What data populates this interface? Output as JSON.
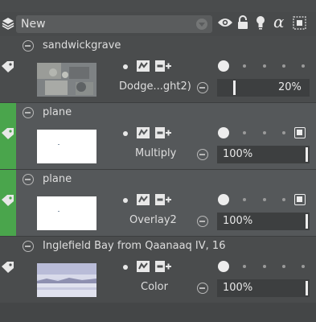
{
  "toolbar": {
    "preset_value": "New",
    "icons": [
      "layers-stack-icon",
      "eye-icon",
      "lock-icon",
      "bulb-icon",
      "alpha-icon",
      "selection-icon"
    ]
  },
  "layers": [
    {
      "title": "sandwickgrave",
      "blend": "Dodge...ght2)",
      "opacity": "20%",
      "opacity_value": 0.2,
      "selected": false,
      "has_mask": false,
      "thumb": "texture"
    },
    {
      "title": "plane",
      "blend": "Multiply",
      "opacity": "100%",
      "opacity_value": 1.0,
      "selected": true,
      "has_mask": true,
      "thumb": "white"
    },
    {
      "title": "plane",
      "blend": "Overlay2",
      "opacity": "100%",
      "opacity_value": 1.0,
      "selected": true,
      "has_mask": true,
      "thumb": "white"
    },
    {
      "title": "Inglefield Bay from Qaanaaq IV, 16",
      "blend": "Color",
      "opacity": "100%",
      "opacity_value": 1.0,
      "selected": false,
      "has_mask": false,
      "thumb": "landscape"
    }
  ],
  "colors": {
    "selection_green": "#4aa54c",
    "selected_bg": "#55585a",
    "panel_bg": "#4a4c4d"
  }
}
